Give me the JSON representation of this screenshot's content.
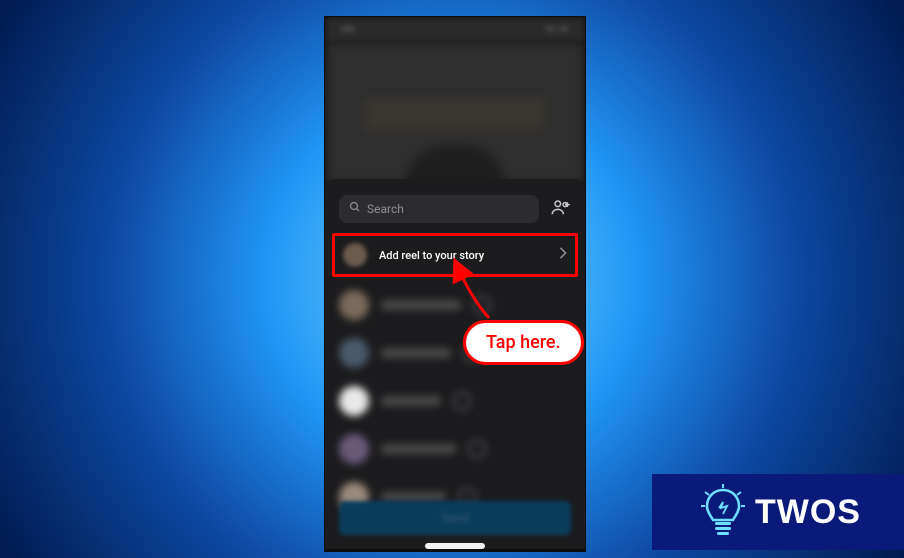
{
  "search": {
    "placeholder": "Search"
  },
  "add_story": {
    "label": "Add reel to your story"
  },
  "send_button": {
    "label": "Send"
  },
  "callout": {
    "text": "Tap here."
  },
  "watermark": {
    "text": "TWOS"
  },
  "contacts_count": 6
}
